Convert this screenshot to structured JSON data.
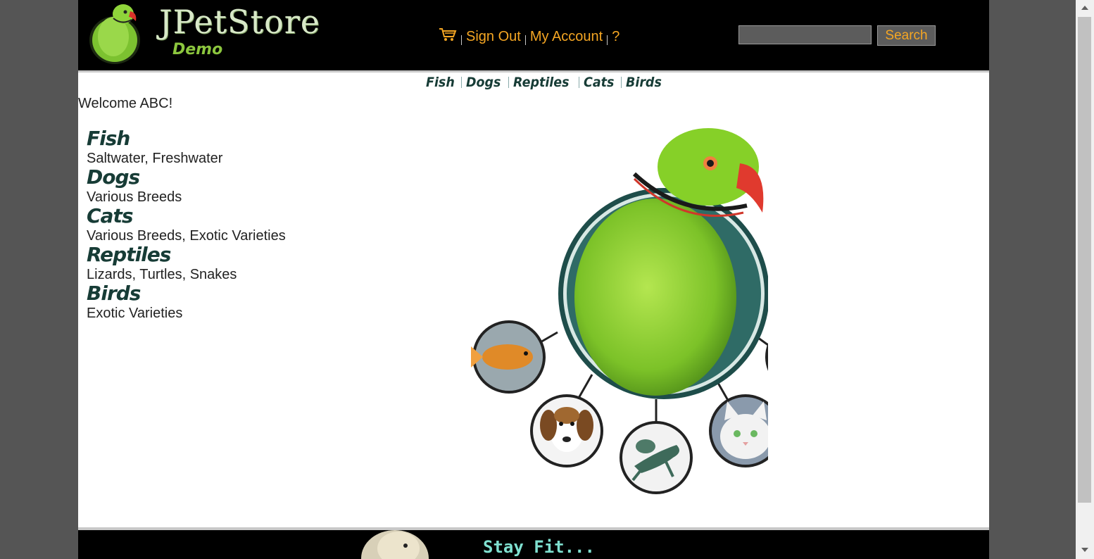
{
  "header": {
    "logo_title": "JPetStore",
    "logo_subtitle": "Demo",
    "menu": {
      "cart_icon": "shopping-cart-icon",
      "sign_out": "Sign Out",
      "my_account": "My Account",
      "help": "?"
    },
    "search": {
      "value": "",
      "button_label": "Search"
    }
  },
  "quick_links": [
    "Fish",
    "Dogs",
    "Reptiles",
    "Cats",
    "Birds"
  ],
  "welcome": "Welcome ABC!",
  "sidebar": {
    "categories": [
      {
        "title": "Fish",
        "subtitle": "Saltwater, Freshwater"
      },
      {
        "title": "Dogs",
        "subtitle": "Various Breeds"
      },
      {
        "title": "Cats",
        "subtitle": "Various Breeds, Exotic Varieties"
      },
      {
        "title": "Reptiles",
        "subtitle": "Lizards, Turtles, Snakes"
      },
      {
        "title": "Birds",
        "subtitle": "Exotic Varieties"
      }
    ]
  },
  "footer": {
    "banner_text": "Stay Fit..."
  },
  "colors": {
    "header_bg": "#000000",
    "link": "#f5a623",
    "category_text": "#173c36"
  }
}
